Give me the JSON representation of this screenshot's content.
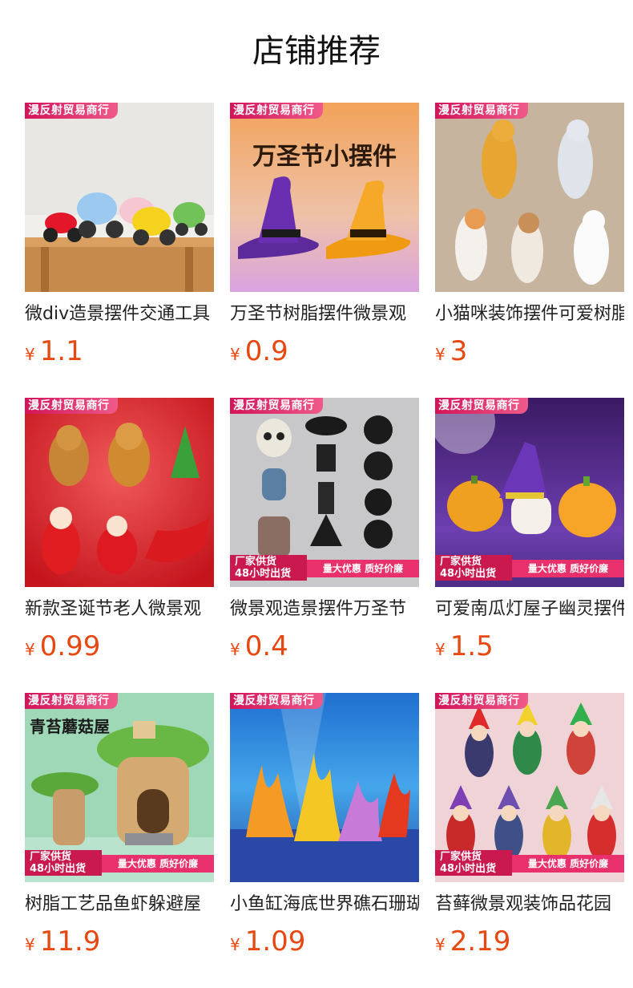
{
  "header": {
    "title": "店铺推荐"
  },
  "products": [
    {
      "shop_tag": "漫反射贸易商行",
      "name": "微div造景摆件交通工具",
      "currency": "¥",
      "price": "1.1"
    },
    {
      "shop_tag": "漫反射贸易商行",
      "name": "万圣节树脂摆件微景观",
      "currency": "¥",
      "price": "0.9",
      "overlay_title": "万圣节小摆件"
    },
    {
      "shop_tag": "漫反射贸易商行",
      "name": "小猫咪装饰摆件可爱树脂",
      "currency": "¥",
      "price": "3"
    },
    {
      "shop_tag": "漫反射贸易商行",
      "name": "新款圣诞节老人微景观",
      "currency": "¥",
      "price": "0.99"
    },
    {
      "shop_tag": "漫反射贸易商行",
      "name": "微景观造景摆件万圣节",
      "currency": "¥",
      "price": "0.4",
      "banner_left": "厂家供货\n48小时出货",
      "banner_right": "量大优惠 质好价廉"
    },
    {
      "shop_tag": "漫反射贸易商行",
      "name": "可爱南瓜灯屋子幽灵摆件",
      "currency": "¥",
      "price": "1.5",
      "banner_left": "厂家供货\n48小时出货",
      "banner_right": "量大优惠 质好价廉"
    },
    {
      "shop_tag": "漫反射贸易商行",
      "name": "树脂工艺品鱼虾躲避屋",
      "currency": "¥",
      "price": "11.9",
      "overlay_title": "青苔蘑菇屋",
      "banner_left": "厂家供货\n48小时出货",
      "banner_right": "量大优惠 质好价廉"
    },
    {
      "shop_tag": "漫反射贸易商行",
      "name": "小鱼缸海底世界礁石珊瑚",
      "currency": "¥",
      "price": "1.09"
    },
    {
      "shop_tag": "漫反射贸易商行",
      "name": "苔藓微景观装饰品花园",
      "currency": "¥",
      "price": "2.19",
      "banner_left": "厂家供货\n48小时出货",
      "banner_right": "量大优惠 质好价廉"
    }
  ],
  "colors": {
    "price": "#e8470f",
    "shop_tag": "#d31458"
  }
}
